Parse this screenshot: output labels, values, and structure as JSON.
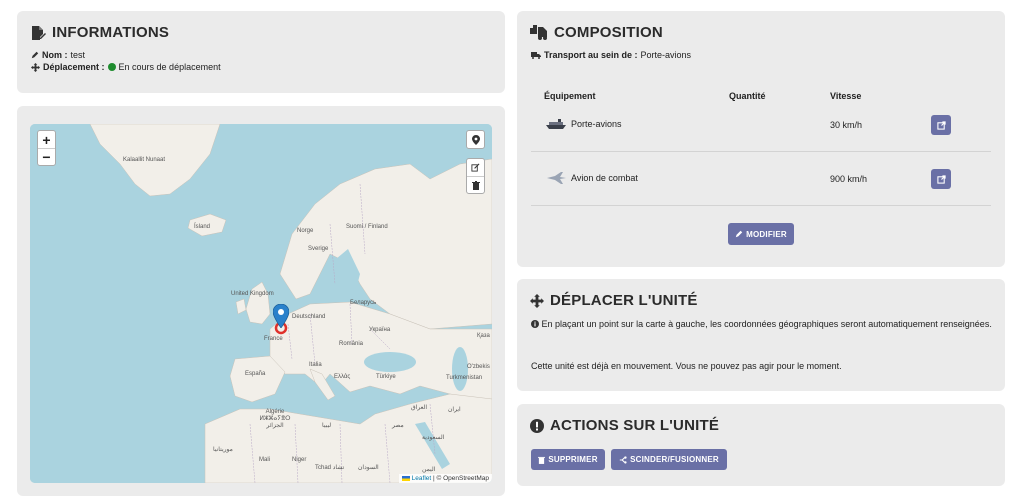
{
  "info": {
    "title": "INFORMATIONS",
    "name_label": "Nom :",
    "name_value": "test",
    "move_label": "Déplacement :",
    "move_value": "En cours de déplacement",
    "status_color": "#1e8c2e"
  },
  "map": {
    "zoom_in": "+",
    "zoom_out": "−",
    "attribution_leaflet": "Leaflet",
    "attribution_osm": "| © OpenStreetMap",
    "labels": [
      "Kalaallit Nunaat",
      "Ísland",
      "Norge",
      "Sverige",
      "Suomi / Finland",
      "United Kingdom",
      "Deutschland",
      "Беларусь",
      "France",
      "Україна",
      "România",
      "Қаза",
      "España",
      "Italia",
      "Ελλάς",
      "Türkiye",
      "O'zbekis",
      "Turkmenistan",
      "Algérie ⵍⵣⵣⴰⵢⴻⵔ الجزائر",
      "Mali",
      "Niger",
      "Tchad تشاد",
      "السودان",
      "مصر",
      "ليبيا",
      "السعودية",
      "اليمن",
      "العراق",
      "ايران",
      "موريتانيا"
    ]
  },
  "composition": {
    "title": "COMPOSITION",
    "transport_label": "Transport au sein de :",
    "transport_value": "Porte-avions",
    "col_equipment": "Équipement",
    "col_quantity": "Quantité",
    "col_speed": "Vitesse",
    "rows": [
      {
        "equipment": "Porte-avions",
        "quantity": "",
        "speed": "30 km/h",
        "icon": "aircraft-carrier-icon"
      },
      {
        "equipment": "Avion de combat",
        "quantity": "",
        "speed": "900 km/h",
        "icon": "fighter-jet-icon"
      }
    ],
    "edit_button": "MODIFIER"
  },
  "move": {
    "title": "DÉPLACER L'UNITÉ",
    "info_text": "En plaçant un point sur la carte à gauche, les coordonnées géographiques seront automatiquement renseignées.",
    "status_text": "Cette unité est déjà en mouvement. Vous ne pouvez pas agir pour le moment."
  },
  "actions": {
    "title": "ACTIONS SUR L'UNITÉ",
    "delete_button": "SUPPRIMER",
    "split_button": "SCINDER/FUSIONNER"
  },
  "colors": {
    "accent": "#6a70a6",
    "card_bg": "#ebebeb",
    "water": "#aad3df",
    "land": "#f2efe9",
    "marker": "#2a81cb",
    "target": "#e0312b"
  }
}
